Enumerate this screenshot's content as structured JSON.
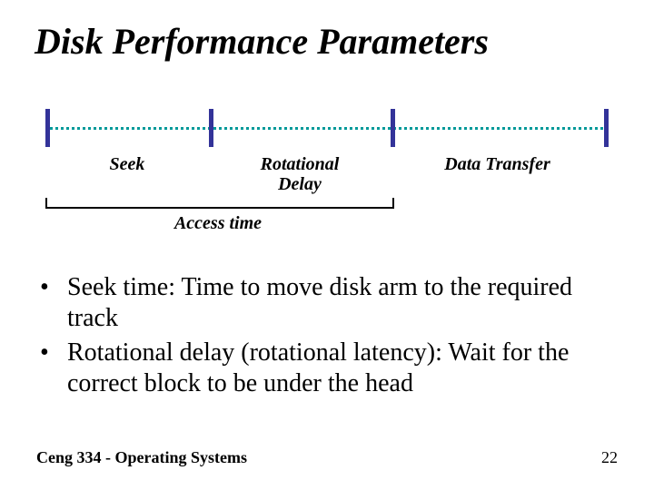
{
  "title": "Disk Performance Parameters",
  "diagram": {
    "seek": "Seek",
    "rotational": "Rotational\nDelay",
    "data_transfer": "Data Transfer",
    "access_time": "Access time"
  },
  "bullets": [
    "Seek time: Time to move disk arm to the required track",
    "Rotational delay (rotational latency): Wait for the correct block to be under the head"
  ],
  "footer": {
    "course": "Ceng 334 - Operating Systems",
    "page": "22"
  }
}
